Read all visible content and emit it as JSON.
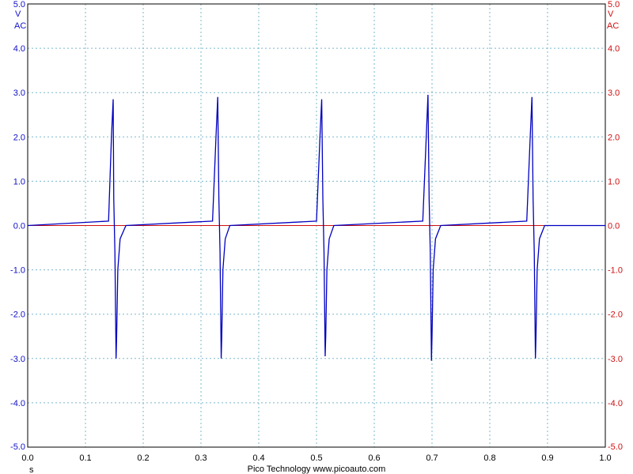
{
  "chart_data": {
    "type": "line",
    "footer": "Pico Technology   www.picoauto.com",
    "x_unit": "s",
    "xlim": [
      0,
      1.0
    ],
    "x_ticks": [
      "0.0",
      "0.1",
      "0.2",
      "0.3",
      "0.4",
      "0.5",
      "0.6",
      "0.7",
      "0.8",
      "0.9",
      "1.0"
    ],
    "y_axis_left": {
      "unit": "V",
      "coupling": "AC",
      "ylim": [
        -5.0,
        5.0
      ],
      "ticks": [
        "5.0",
        "4.0",
        "3.0",
        "2.0",
        "1.0",
        "0.0",
        "-1.0",
        "-2.0",
        "-3.0",
        "-4.0",
        "-5.0"
      ],
      "color": "#1010c8"
    },
    "y_axis_right": {
      "unit": "V",
      "coupling": "AC",
      "ylim": [
        -5.0,
        5.0
      ],
      "ticks": [
        "5.0",
        "4.0",
        "3.0",
        "2.0",
        "1.0",
        "0.0",
        "-1.0",
        "-2.0",
        "-3.0",
        "-4.0",
        "-5.0"
      ],
      "color": "#d01010"
    },
    "grid": true,
    "series": [
      {
        "channel": "A",
        "color": "#0000c0",
        "x": [
          0.0,
          0.14,
          0.145,
          0.148,
          0.149,
          0.151,
          0.153,
          0.154,
          0.156,
          0.16,
          0.17,
          0.32,
          0.326,
          0.329,
          0.331,
          0.333,
          0.335,
          0.336,
          0.338,
          0.342,
          0.35,
          0.5,
          0.506,
          0.509,
          0.511,
          0.513,
          0.515,
          0.516,
          0.518,
          0.522,
          0.53,
          0.684,
          0.69,
          0.693,
          0.695,
          0.697,
          0.699,
          0.7,
          0.702,
          0.706,
          0.715,
          0.864,
          0.87,
          0.873,
          0.875,
          0.877,
          0.879,
          0.88,
          0.882,
          0.886,
          0.895,
          1.0
        ],
        "y": [
          0.0,
          0.1,
          2.0,
          2.85,
          0.6,
          -0.6,
          -3.0,
          -2.5,
          -1.0,
          -0.3,
          0.0,
          0.1,
          2.0,
          2.9,
          0.6,
          -0.6,
          -3.0,
          -2.5,
          -1.0,
          -0.3,
          0.0,
          0.1,
          2.0,
          2.85,
          0.6,
          -0.6,
          -2.95,
          -2.5,
          -1.0,
          -0.3,
          0.0,
          0.1,
          2.0,
          2.95,
          0.6,
          -0.6,
          -3.05,
          -2.5,
          -1.0,
          -0.3,
          0.0,
          0.1,
          2.0,
          2.9,
          0.6,
          -0.6,
          -3.0,
          -2.5,
          -1.0,
          -0.3,
          0.0,
          0.0
        ]
      },
      {
        "channel": "B",
        "color": "#d01010",
        "x": [
          0.0,
          1.0
        ],
        "y": [
          0.0,
          0.0
        ]
      }
    ]
  }
}
